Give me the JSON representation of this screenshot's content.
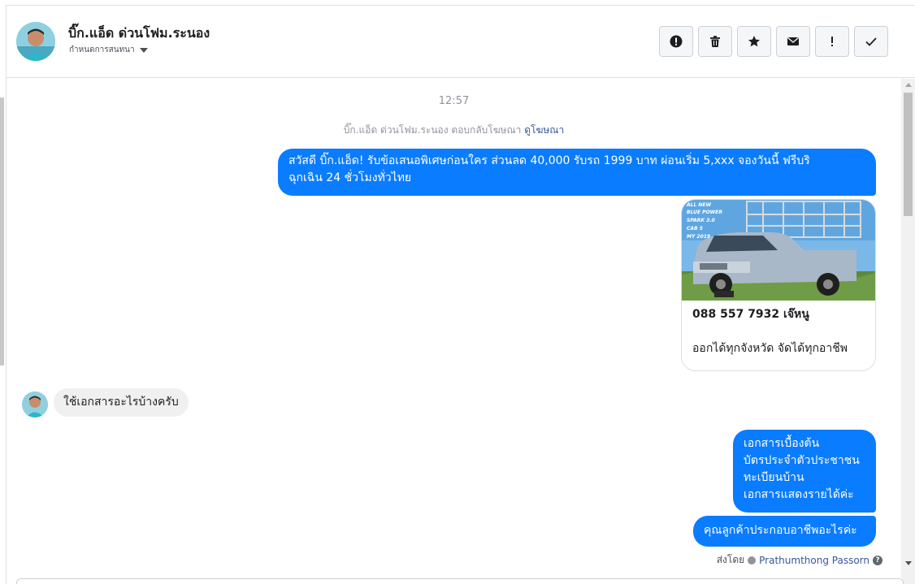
{
  "header": {
    "contact_name": "บิ๊ก.แอ็ด ด่วนโฟม.ระนอง",
    "subtitle": "กำหนดการสนทนา",
    "toolbar": [
      "alert-icon",
      "trash-icon",
      "star-icon",
      "envelope-icon",
      "exclamation-icon",
      "check-icon"
    ]
  },
  "thread": {
    "timestamp": "12:57",
    "system_note": "บิ๊ก.แอ็ด ด่วนโฟม.ระนอง ตอบกลับโฆษณา",
    "system_link": "ดูโฆษณา",
    "outgoing_1": {
      "line1": "สวัสดี บิ๊ก.แอ็ด! รับข้อเสนอพิเศษก่อนใคร ส่วนลด 40,000 รับรถ 1999 บาท ผ่อนเริ่ม 5,xxx จองวันนี้ ฟรีบริ",
      "line2": "ฉุกเฉิน 24 ชั่วโมงทั่วไทย"
    },
    "card": {
      "image_text": [
        "ALL NEW",
        "BLUE POWER",
        "SPARK 3.0",
        "CAB 5",
        "MY 2019"
      ],
      "title": "088 557 7932 เจ๊หนู",
      "description": "ออกได้ทุกจังหวัด จัดได้ทุกอาชีพ"
    },
    "incoming_1": "ใช้เอกสารอะไรบ้างครับ",
    "outgoing_2": {
      "line1": "เอกสารเบื้องต้น",
      "line2": "บัตรประจำตัวประชาชน",
      "line3": "ทะเบียนบ้าน",
      "line4": "เอกสารแสดงรายได้ค่ะ"
    },
    "outgoing_3": "คุณลูกค้าประกอบอาชีพอะไรค่ะ",
    "sent_by_label": "ส่งโดย",
    "sent_by_name": "Prathumthong Passorn"
  },
  "colors": {
    "outgoing_bubble": "#0a7cff",
    "incoming_bubble": "#f1f0f0",
    "link": "#365899"
  }
}
